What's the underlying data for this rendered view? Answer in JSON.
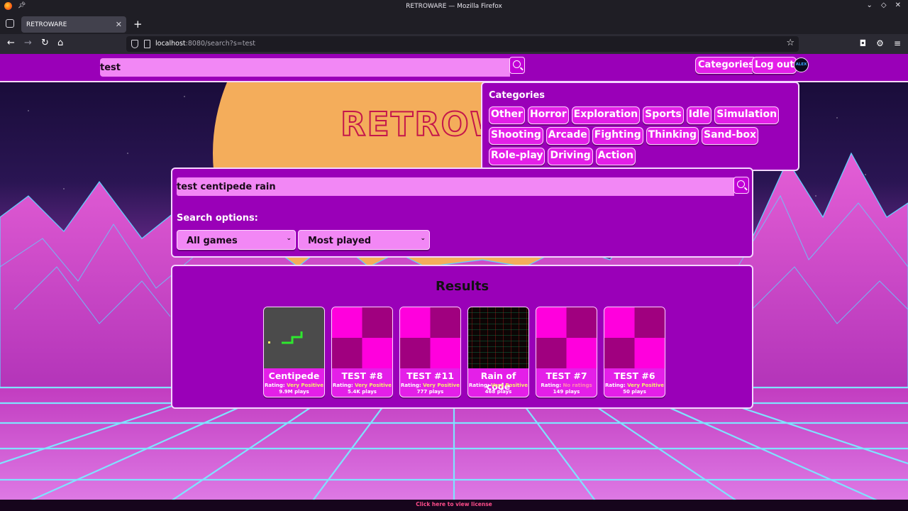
{
  "browser": {
    "window_title": "RETROWARE — Mozilla Firefox",
    "tab_title": "RETROWARE",
    "url_host": "localhost",
    "url_rest": ":8080/search?s=test"
  },
  "topbar": {
    "search_value": "test",
    "categories_label": "Categories",
    "logout_label": "Log out",
    "avatar_text": "ALEX"
  },
  "logo": {
    "text": "RETROWA"
  },
  "categories_panel": {
    "title": "Categories",
    "rows": [
      [
        "Other",
        "Horror",
        "Exploration",
        "Sports",
        "Idle",
        "Simulation"
      ],
      [
        "Shooting",
        "Arcade",
        "Fighting",
        "Thinking",
        "Sand-box"
      ],
      [
        "Role-play",
        "Driving",
        "Action"
      ]
    ]
  },
  "search_panel": {
    "query": "test centipede rain",
    "options_label": "Search options:",
    "filter_value": "All games",
    "sort_value": "Most played"
  },
  "results": {
    "title": "Results",
    "rating_prefix": "Rating:",
    "cards": [
      {
        "name": "Centipede",
        "rating": "Very Positive",
        "plays": "9.9M plays",
        "thumb": "snake"
      },
      {
        "name": "TEST #8",
        "rating": "Very Positive",
        "plays": "5.4K plays",
        "thumb": "checker"
      },
      {
        "name": "TEST #11",
        "rating": "Very Positive",
        "plays": "777 plays",
        "thumb": "checker"
      },
      {
        "name": "Rain of code",
        "rating": "Very Positive",
        "plays": "468 plays",
        "thumb": "rain"
      },
      {
        "name": "TEST #7",
        "rating": "No ratings",
        "plays": "149 plays",
        "thumb": "checker"
      },
      {
        "name": "TEST #6",
        "rating": "Very Positive",
        "plays": "50 plays",
        "thumb": "checker"
      }
    ]
  },
  "footer": {
    "license_link": "Click here to view license"
  },
  "colors": {
    "panel_purple": "#9a00b8",
    "chip_pink": "#e41fe8",
    "input_pink": "#f287f5",
    "rating_positive": "#f4f06a",
    "rating_none": "#ff89b0"
  }
}
